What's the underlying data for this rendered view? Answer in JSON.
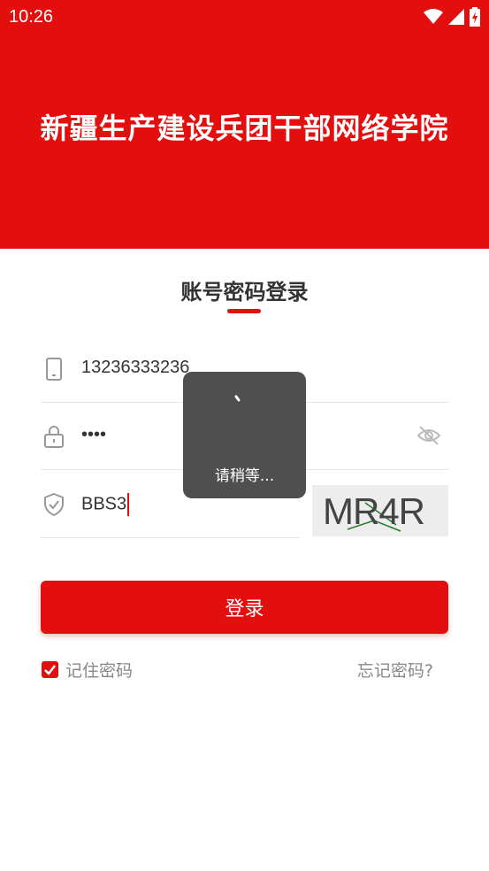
{
  "status_bar": {
    "time": "10:26"
  },
  "header": {
    "title": "新疆生产建设兵团干部网络学院"
  },
  "login_tab": {
    "title": "账号密码登录"
  },
  "form": {
    "phone_value": "13236333236",
    "password_value": "••••",
    "captcha_value": "BBS3",
    "captcha_image_text": "MR4R"
  },
  "actions": {
    "login_label": "登录",
    "remember_label": "记住密码",
    "forgot_label": "忘记密码?"
  },
  "toast": {
    "message": "请稍等..."
  },
  "colors": {
    "brand_red": "#e30e0e",
    "toast_bg": "#464646"
  }
}
